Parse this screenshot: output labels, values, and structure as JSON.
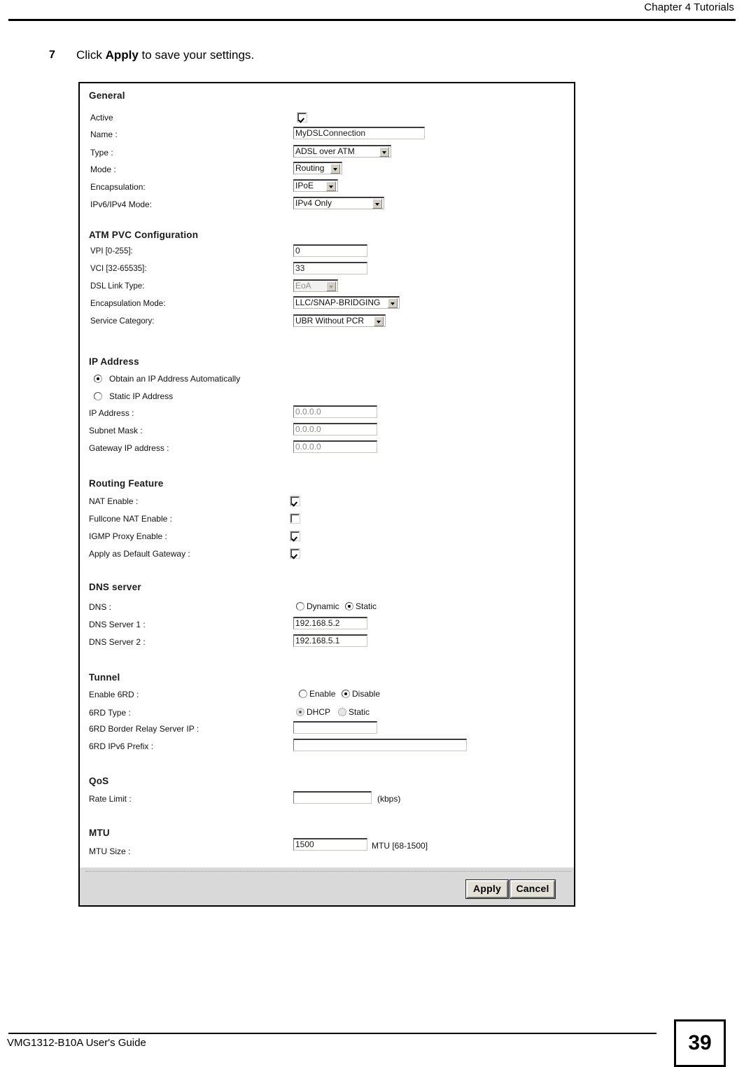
{
  "page": {
    "chapter_header": "Chapter 4 Tutorials",
    "step_number": "7",
    "step_text_before": "Click ",
    "step_text_bold": "Apply",
    "step_text_after": " to save your settings.",
    "footer_guide": "VMG1312-B10A User's Guide",
    "page_number": "39"
  },
  "form": {
    "general": {
      "title": "General",
      "active_label": "Active",
      "active_checked": true,
      "name_label": "Name :",
      "name_value": "MyDSLConnection",
      "type_label": "Type :",
      "type_value": "ADSL over ATM",
      "mode_label": "Mode :",
      "mode_value": "Routing",
      "encapsulation_label": "Encapsulation:",
      "encapsulation_value": "IPoE",
      "ipmode_label": "IPv6/IPv4 Mode:",
      "ipmode_value": "IPv4 Only"
    },
    "atm_pvc": {
      "title": "ATM PVC Configuration",
      "vpi_label": "VPI [0-255]:",
      "vpi_value": "0",
      "vci_label": "VCI [32-65535]:",
      "vci_value": "33",
      "dsl_link_type_label": "DSL Link Type:",
      "dsl_link_type_value": "EoA",
      "encap_mode_label": "Encapsulation Mode:",
      "encap_mode_value": "LLC/SNAP-BRIDGING",
      "service_category_label": "Service Category:",
      "service_category_value": "UBR Without PCR"
    },
    "ip_address": {
      "title": "IP Address",
      "auto_label": "Obtain an IP Address Automatically",
      "static_label": "Static IP Address",
      "selected": "auto",
      "ip_label": "IP Address :",
      "ip_value": "0.0.0.0",
      "subnet_label": "Subnet Mask :",
      "subnet_value": "0.0.0.0",
      "gateway_label": "Gateway IP address :",
      "gateway_value": "0.0.0.0"
    },
    "routing_feature": {
      "title": "Routing Feature",
      "nat_label": "NAT Enable :",
      "nat_checked": true,
      "fullcone_label": "Fullcone NAT Enable :",
      "fullcone_checked": false,
      "igmp_label": "IGMP Proxy Enable :",
      "igmp_checked": true,
      "default_gw_label": "Apply as Default Gateway :",
      "default_gw_checked": true
    },
    "dns_server": {
      "title": "DNS server",
      "dns_label": "DNS :",
      "dynamic_label": "Dynamic",
      "static_label": "Static",
      "selected": "static",
      "server1_label": "DNS Server 1 :",
      "server1_value": "192.168.5.2",
      "server2_label": "DNS Server 2 :",
      "server2_value": "192.168.5.1"
    },
    "tunnel": {
      "title": "Tunnel",
      "enable6rd_label": "Enable 6RD :",
      "enable_label": "Enable",
      "disable_label": "Disable",
      "enable6rd_selected": "disable",
      "type6rd_label": "6RD Type :",
      "dhcp_label": "DHCP",
      "static_label": "Static",
      "type6rd_selected": "dhcp",
      "border_relay_label": "6RD Border Relay Server IP :",
      "border_relay_value": "",
      "prefix_label": "6RD IPv6 Prefix :",
      "prefix_value": ""
    },
    "qos": {
      "title": "QoS",
      "rate_limit_label": "Rate Limit :",
      "rate_limit_value": "",
      "rate_limit_unit": "(kbps)"
    },
    "mtu": {
      "title": "MTU",
      "mtu_size_label": "MTU Size :",
      "mtu_size_value": "1500",
      "mtu_hint": "MTU [68-1500]"
    },
    "buttons": {
      "apply": "Apply",
      "cancel": "Cancel"
    }
  }
}
